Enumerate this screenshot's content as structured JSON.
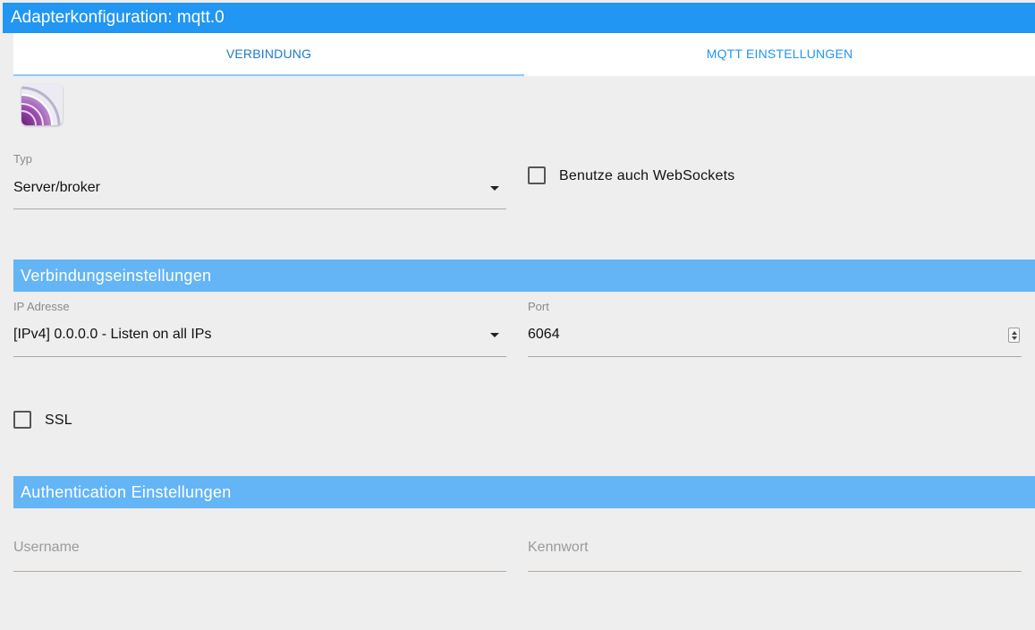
{
  "window": {
    "title": "Adapterkonfiguration: mqtt.0"
  },
  "tabs": [
    {
      "label": "VERBINDUNG",
      "active": true
    },
    {
      "label": "MQTT EINSTELLUNGEN",
      "active": false
    }
  ],
  "adapter_logo": {
    "icon": "mqtt-broadcast-icon"
  },
  "typ": {
    "label": "Typ",
    "value": "Server/broker"
  },
  "websockets": {
    "label": "Benutze auch WebSockets",
    "checked": false
  },
  "sections": {
    "connection": "Verbindungseinstellungen",
    "auth": "Authentication Einstellungen"
  },
  "ip": {
    "label": "IP Adresse",
    "value": "[IPv4] 0.0.0.0 - Listen on all IPs"
  },
  "port": {
    "label": "Port",
    "value": "6064"
  },
  "ssl": {
    "label": "SSL",
    "checked": false
  },
  "username": {
    "placeholder": "Username",
    "value": ""
  },
  "password": {
    "placeholder": "Kennwort",
    "value": ""
  },
  "colors": {
    "titlebar": "#2196f3",
    "section": "#64b5f6",
    "background": "#eeeeee"
  }
}
